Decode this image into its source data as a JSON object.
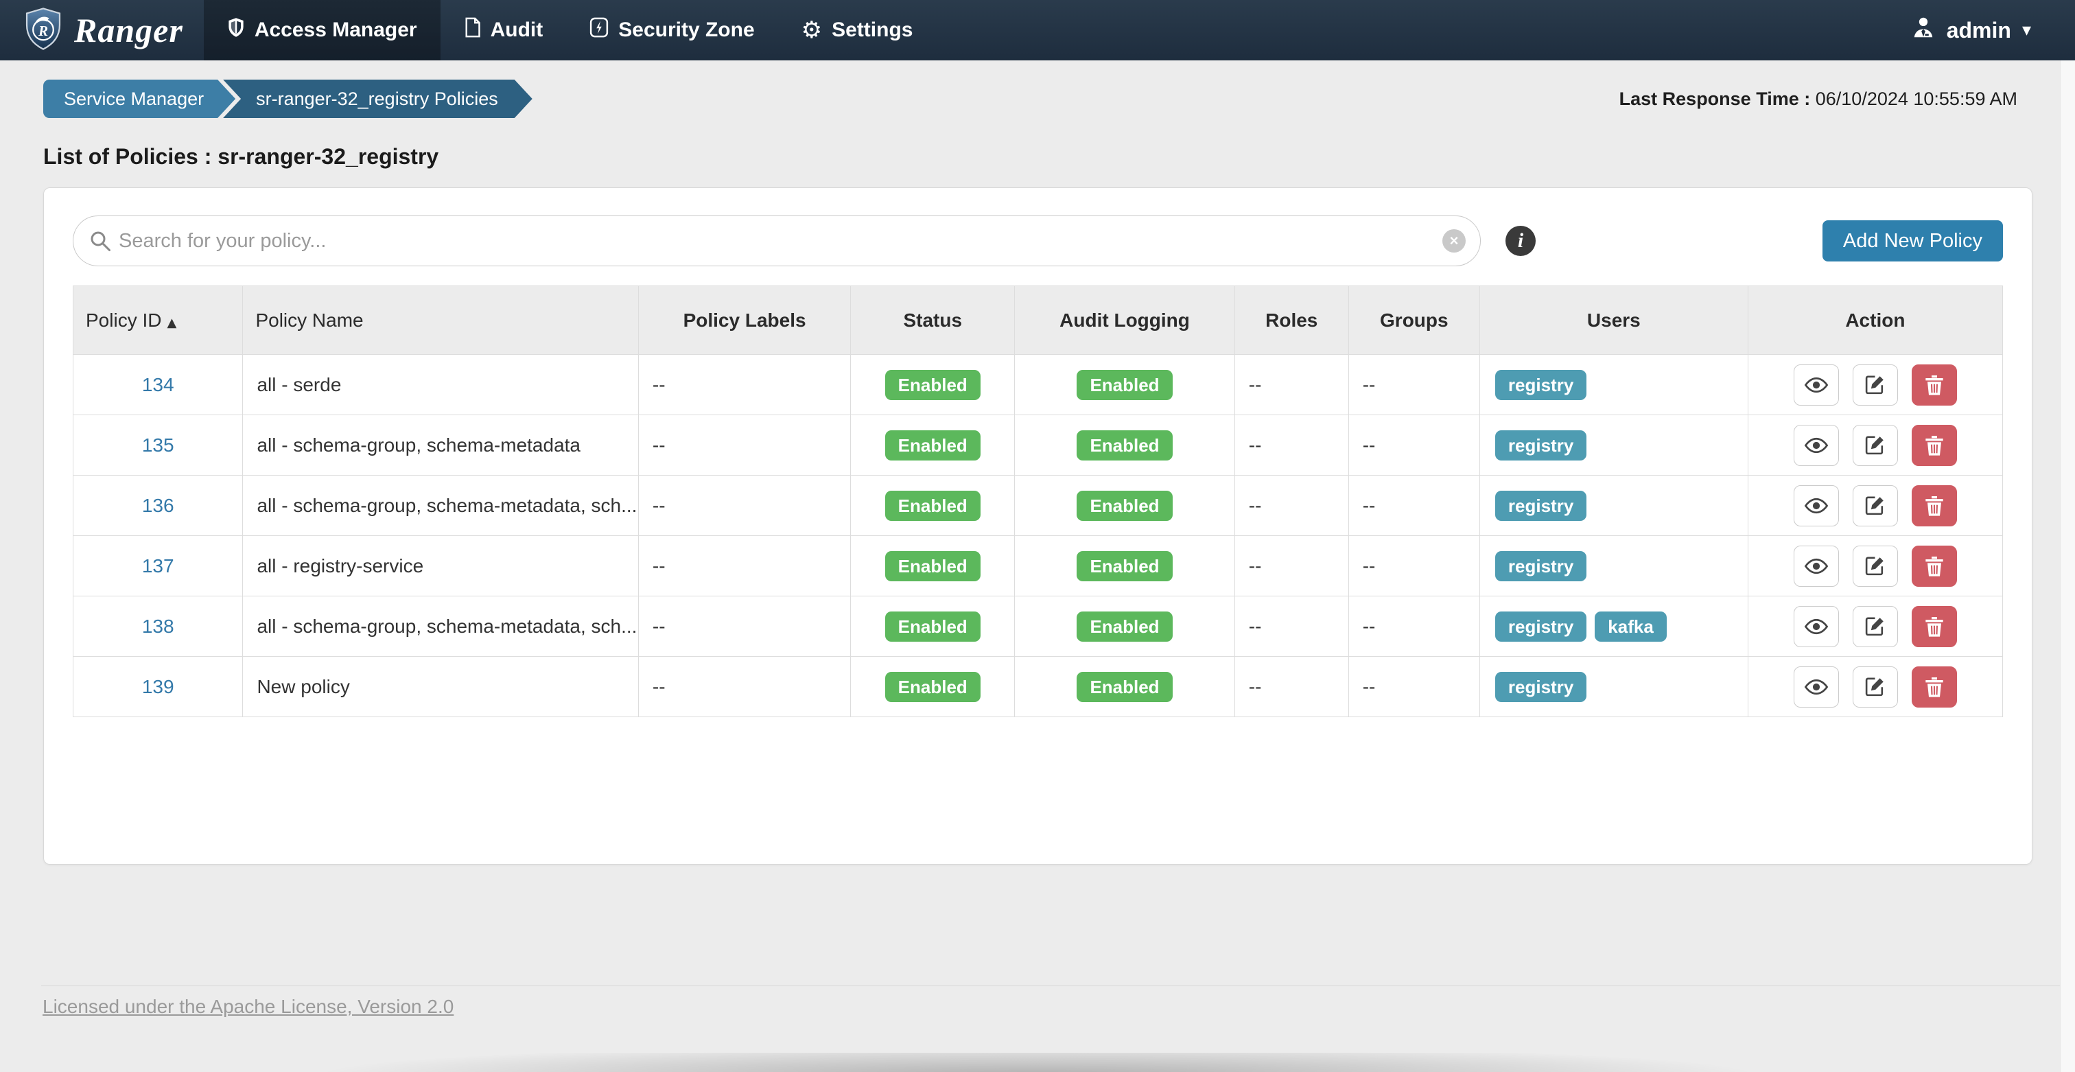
{
  "navbar": {
    "brand": "Ranger",
    "items": [
      {
        "label": "Access Manager",
        "icon": "shield-icon",
        "active": true
      },
      {
        "label": "Audit",
        "icon": "document-icon",
        "active": false
      },
      {
        "label": "Security Zone",
        "icon": "zone-bolt-icon",
        "active": false
      },
      {
        "label": "Settings",
        "icon": "gear-icon",
        "active": false
      }
    ],
    "user": {
      "name": "admin",
      "icon": "user-icon"
    }
  },
  "breadcrumb": {
    "items": [
      "Service Manager",
      "sr-ranger-32_registry Policies"
    ]
  },
  "header": {
    "last_response_label": "Last Response Time :",
    "last_response_value": "06/10/2024 10:55:59 AM",
    "page_title": "List of Policies : sr-ranger-32_registry"
  },
  "toolbar": {
    "search_placeholder": "Search for your policy...",
    "info_glyph": "i",
    "clear_glyph": "×",
    "add_button_label": "Add New Policy"
  },
  "table": {
    "columns": [
      "Policy ID",
      "Policy Name",
      "Policy Labels",
      "Status",
      "Audit Logging",
      "Roles",
      "Groups",
      "Users",
      "Action"
    ],
    "sort_column": "Policy ID",
    "sort_direction": "asc",
    "rows": [
      {
        "id": "134",
        "name": "all - serde",
        "labels": "--",
        "status": "Enabled",
        "audit": "Enabled",
        "roles": "--",
        "groups": "--",
        "users": [
          "registry"
        ]
      },
      {
        "id": "135",
        "name": "all - schema-group, schema-metadata",
        "labels": "--",
        "status": "Enabled",
        "audit": "Enabled",
        "roles": "--",
        "groups": "--",
        "users": [
          "registry"
        ]
      },
      {
        "id": "136",
        "name": "all - schema-group, schema-metadata, sch...",
        "labels": "--",
        "status": "Enabled",
        "audit": "Enabled",
        "roles": "--",
        "groups": "--",
        "users": [
          "registry"
        ]
      },
      {
        "id": "137",
        "name": "all - registry-service",
        "labels": "--",
        "status": "Enabled",
        "audit": "Enabled",
        "roles": "--",
        "groups": "--",
        "users": [
          "registry"
        ]
      },
      {
        "id": "138",
        "name": "all - schema-group, schema-metadata, sch...",
        "labels": "--",
        "status": "Enabled",
        "audit": "Enabled",
        "roles": "--",
        "groups": "--",
        "users": [
          "registry",
          "kafka"
        ]
      },
      {
        "id": "139",
        "name": "New policy",
        "labels": "--",
        "status": "Enabled",
        "audit": "Enabled",
        "roles": "--",
        "groups": "--",
        "users": [
          "registry"
        ]
      }
    ]
  },
  "footer": {
    "license_text": "Licensed under the Apache License, Version 2.0"
  },
  "colors": {
    "navbar_bg": "#1e2d3e",
    "breadcrumb_primary": "#3d7ea6",
    "breadcrumb_secondary": "#2d6081",
    "accent_button": "#2e80ad",
    "status_enabled": "#5cb85c",
    "user_badge": "#4e9cb2",
    "delete_button": "#cf5a62"
  }
}
